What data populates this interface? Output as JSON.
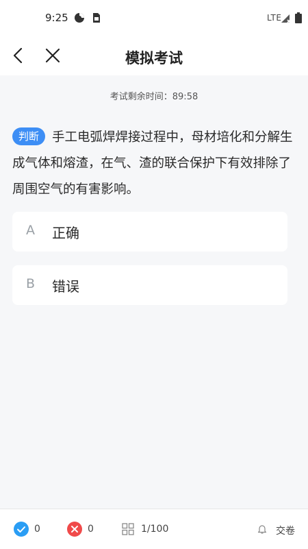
{
  "status": {
    "time": "9:25",
    "network": "LTE"
  },
  "header": {
    "title": "模拟考试"
  },
  "timer": {
    "text": "考试剩余时间：89:58"
  },
  "question": {
    "type": "判断",
    "text": "手工电弧焊焊接过程中，母材培化和分解生成气体和熔渣，在气、渣的联合保护下有效排除了周围空气的有害影响。"
  },
  "options": [
    {
      "letter": "A",
      "text": "正确"
    },
    {
      "letter": "B",
      "text": "错误"
    }
  ],
  "footer": {
    "correct_count": "0",
    "wrong_count": "0",
    "progress": "1/100",
    "submit_label": "交卷"
  },
  "colors": {
    "accent": "#3d8ef5",
    "correct": "#2a9df4",
    "wrong": "#f04a4a"
  }
}
